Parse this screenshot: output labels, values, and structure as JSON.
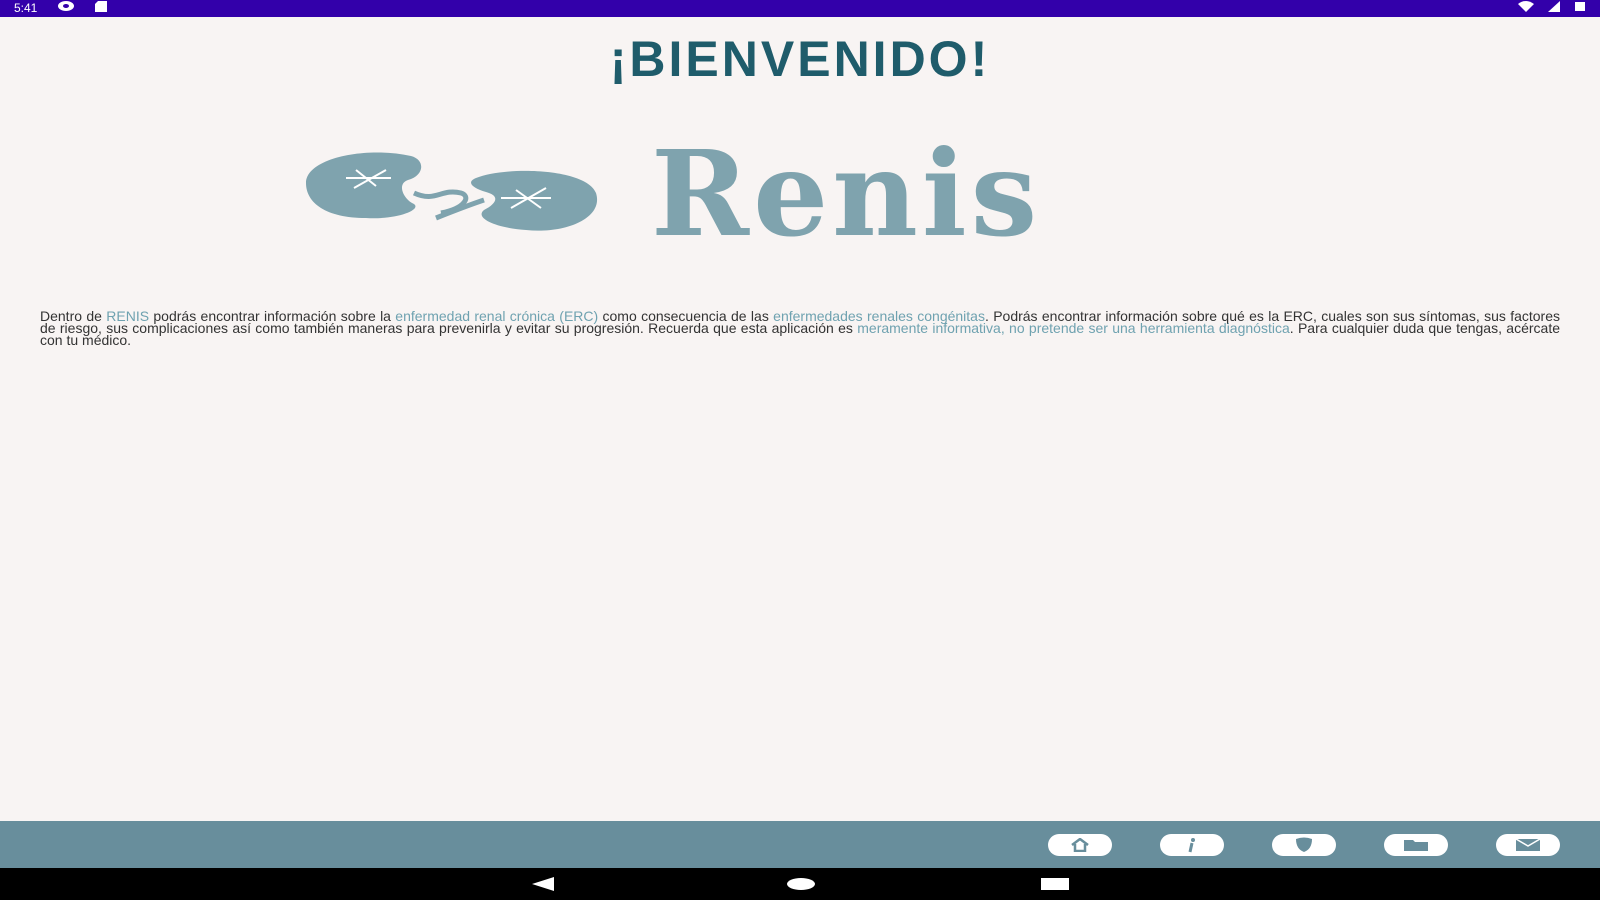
{
  "status_bar": {
    "time": "5:41",
    "left_icons": [
      "sync-icon",
      "sd-card-icon"
    ],
    "right_icons": [
      "wifi-icon",
      "signal-icon",
      "battery-icon"
    ]
  },
  "page": {
    "title": "¡BIENVENIDO!",
    "logo_text": "Renis"
  },
  "intro": {
    "segments": [
      {
        "text": "Dentro de ",
        "hl": false
      },
      {
        "text": "RENIS",
        "hl": true
      },
      {
        "text": " podrás encontrar información sobre la ",
        "hl": false
      },
      {
        "text": "enfermedad renal crónica (ERC)",
        "hl": true
      },
      {
        "text": " como consecuencia de las ",
        "hl": false
      },
      {
        "text": "enfermedades renales congénitas",
        "hl": true
      },
      {
        "text": ". Podrás encontrar información sobre qué es la ERC, cuales son sus síntomas, sus factores de riesgo, sus complicaciones así como también maneras para prevenirla y evitar su progresión. Recuerda que esta aplicación es ",
        "hl": false
      },
      {
        "text": "meramente informativa, no pretende ser una herramienta diagnóstica",
        "hl": true
      },
      {
        "text": ". Para cualquier duda que tengas, acércate con tu médico.",
        "hl": false
      }
    ]
  },
  "bottom_nav": {
    "items": [
      {
        "name": "home-icon"
      },
      {
        "name": "info-icon"
      },
      {
        "name": "shield-icon"
      },
      {
        "name": "folder-icon"
      },
      {
        "name": "mail-icon"
      }
    ]
  },
  "colors": {
    "status_bar": "#3300aa",
    "background": "#f8f4f3",
    "title": "#1f5c6b",
    "logo": "#7fa3ae",
    "highlight": "#6fa2b0",
    "bottom_bar": "#688e9c"
  }
}
